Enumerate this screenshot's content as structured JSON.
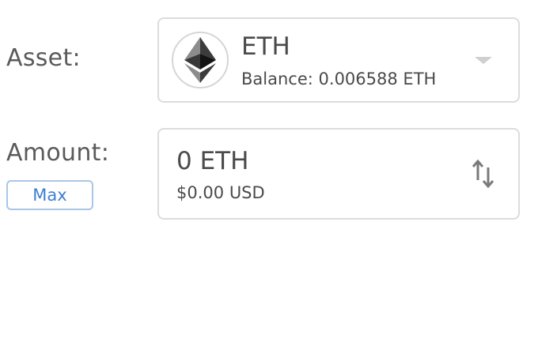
{
  "asset": {
    "label": "Asset:",
    "symbol": "ETH",
    "balance_prefix": "Balance:",
    "balance_value": "0.006588",
    "balance_unit": "ETH",
    "icon": "ethereum-logo-icon",
    "dropdown_icon": "caret-down-icon"
  },
  "amount": {
    "label": "Amount:",
    "max_label": "Max",
    "value": "0",
    "unit": "ETH",
    "fiat_value": "$0.00",
    "fiat_unit": "USD",
    "swap_icon": "swap-vertical-icon"
  },
  "colors": {
    "accent": "#3b7fd1",
    "border": "#dcdcdc",
    "text": "#4a4a4a"
  }
}
